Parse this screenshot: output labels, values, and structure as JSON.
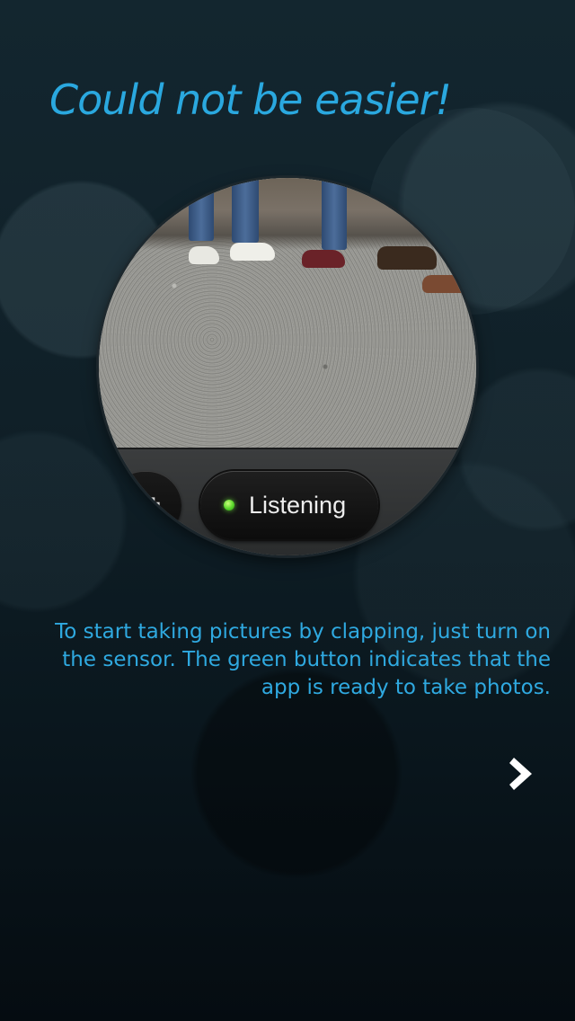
{
  "onboarding": {
    "title": "Could not be easier!",
    "description": "To start taking pictures by clapping, just turn on the sensor. The green button indicates that the app is ready to take photos.",
    "status_button": {
      "label": "Listening",
      "indicator_color": "#57d62a"
    },
    "side_button_icon": "camera-icon",
    "next_icon": "chevron-right-icon"
  },
  "colors": {
    "accent": "#2aa8df",
    "background": "#0a1a22"
  }
}
